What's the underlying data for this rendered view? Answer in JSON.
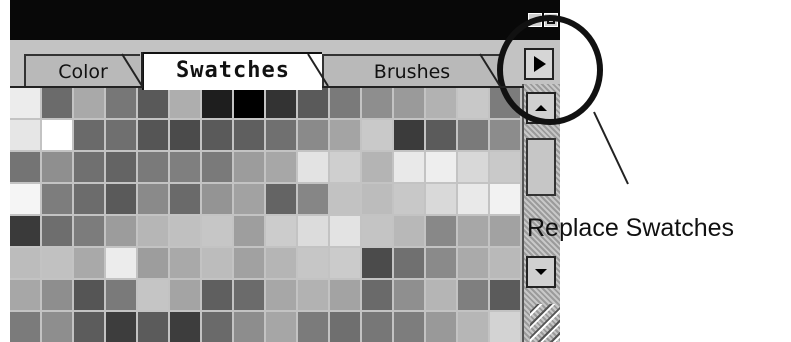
{
  "tabs": [
    {
      "label": "Color",
      "active": false
    },
    {
      "label": "Swatches",
      "active": true
    },
    {
      "label": "Brushes",
      "active": false
    }
  ],
  "callout": {
    "label": "Replace Swatches"
  },
  "swatch_colors": [
    [
      "#ececec",
      "#6b6b6b",
      "#a9a9a9",
      "#777777",
      "#595959",
      "#aeaeae",
      "#1e1e1e",
      "#000000",
      "#333333",
      "#5a5a5a",
      "#7a7a7a",
      "#8e8e8e",
      "#9a9a9a",
      "#b2b2b2",
      "#c8c8c8",
      "#7c7c7c",
      "#595959"
    ],
    [
      "#e6e6e6",
      "#ffffff",
      "#6a6a6a",
      "#6f6f6f",
      "#555555",
      "#4b4b4b",
      "#5a5a5a",
      "#5f5f5f",
      "#707070",
      "#8a8a8a",
      "#a4a4a4",
      "#c9c9c9",
      "#3b3b3b",
      "#5b5b5b",
      "#7a7a7a",
      "#8c8c8c",
      "#a3a3a3"
    ],
    [
      "#747474",
      "#8f8f8f",
      "#707070",
      "#646464",
      "#7a7a7a",
      "#7f7f7f",
      "#7a7a7a",
      "#9c9c9c",
      "#a7a7a7",
      "#e3e3e3",
      "#cfcfcf",
      "#b4b4b4",
      "#e9e9e9",
      "#eeeeee",
      "#d8d8d8",
      "#c9c9c9",
      "#e7e7e7"
    ],
    [
      "#f5f5f5",
      "#7d7d7d",
      "#6c6c6c",
      "#5a5a5a",
      "#8a8a8a",
      "#6a6a6a",
      "#949494",
      "#a2a2a2",
      "#646464",
      "#868686",
      "#c2c2c2",
      "#bcbcbc",
      "#c8c8c8",
      "#d9d9d9",
      "#e9e9e9",
      "#f2f2f2",
      "#444444"
    ],
    [
      "#3a3a3a",
      "#6e6e6e",
      "#7c7c7c",
      "#9c9c9c",
      "#b6b6b6",
      "#c0c0c0",
      "#c6c6c6",
      "#9e9e9e",
      "#cccccc",
      "#dcdcdc",
      "#e3e3e3",
      "#c4c4c4",
      "#b8b8b8",
      "#888888",
      "#a7a7a7",
      "#a2a2a2",
      "#cdcdcd"
    ],
    [
      "#bcbcbc",
      "#c1c1c1",
      "#a9a9a9",
      "#ececec",
      "#9d9d9d",
      "#a9a9a9",
      "#bcbcbc",
      "#a1a1a1",
      "#b5b5b5",
      "#c6c6c6",
      "#cbcbcb",
      "#4b4b4b",
      "#707070",
      "#8a8a8a",
      "#aaaaaa",
      "#b9b9b9",
      "#6c6c6c"
    ],
    [
      "#a7a7a7",
      "#8e8e8e",
      "#555555",
      "#7a7a7a",
      "#c5c5c5",
      "#a4a4a4",
      "#5f5f5f",
      "#6b6b6b",
      "#a7a7a7",
      "#b2b2b2",
      "#a3a3a3",
      "#6a6a6a",
      "#8f8f8f",
      "#b5b5b5",
      "#7f7f7f",
      "#5b5b5b",
      "#9d9d9d"
    ],
    [
      "#7b7b7b",
      "#8e8e8e",
      "#5c5c5c",
      "#3d3d3d",
      "#5b5b5b",
      "#3d3d3d",
      "#6a6a6a",
      "#8d8d8d",
      "#a6a6a6",
      "#7b7b7b",
      "#6f6f6f",
      "#777777",
      "#7d7d7d",
      "#999999",
      "#b6b6b6",
      "#d3d3d3",
      "#e7e7e7"
    ]
  ]
}
